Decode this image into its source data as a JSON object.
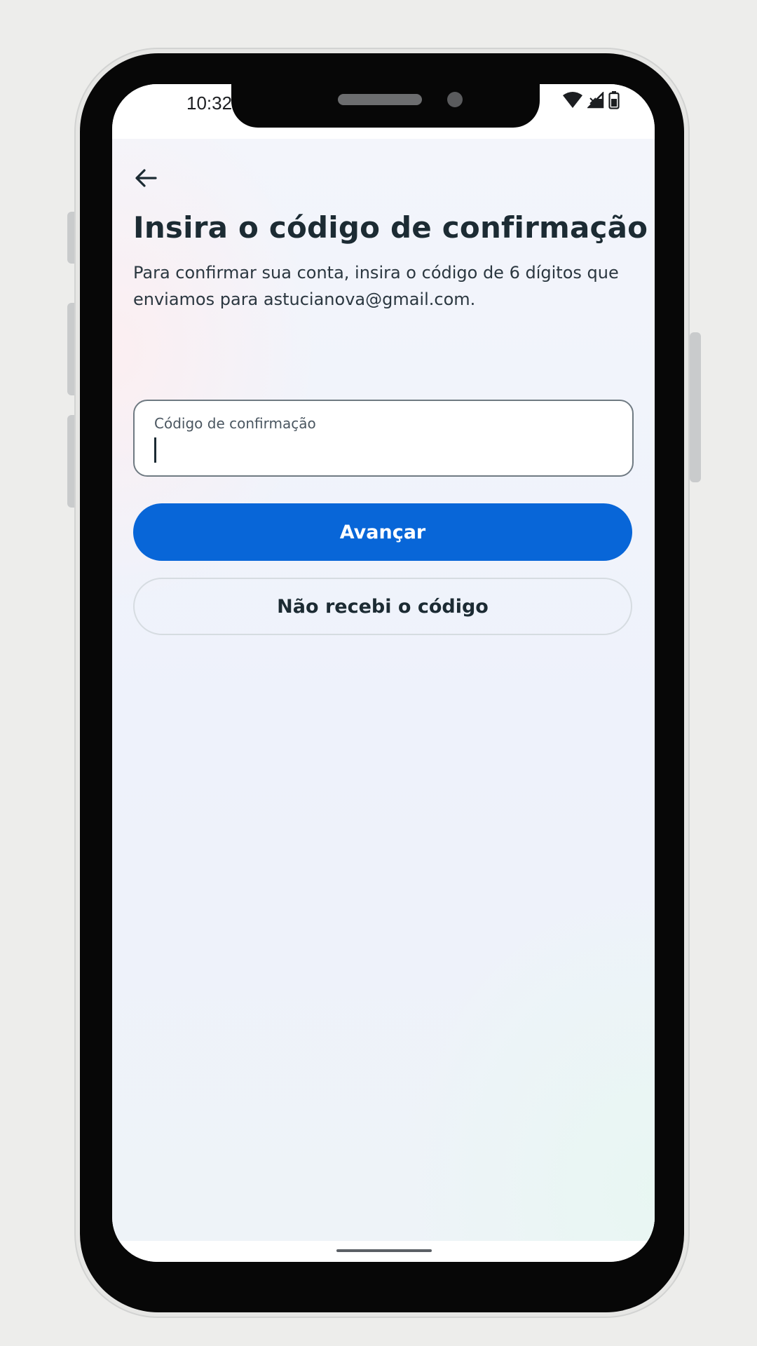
{
  "status_bar": {
    "time": "10:32",
    "wifi_icon": "wifi-icon",
    "signal_icon": "signal-icon",
    "battery_icon": "battery-icon"
  },
  "header": {
    "back_icon": "arrow-left-icon"
  },
  "main": {
    "title": "Insira o código de confirmação",
    "subtitle": "Para confirmar sua conta, insira o código de 6 dígitos que enviamos para astucianova@gmail.com."
  },
  "code_field": {
    "label": "Código de confirmação",
    "value": ""
  },
  "actions": {
    "next_label": "Avançar",
    "resend_label": "Não recebi o código"
  },
  "colors": {
    "primary": "#0866d8",
    "text": "#1c2b33",
    "border": "#6f7a82",
    "background": "#f3f5fb"
  }
}
